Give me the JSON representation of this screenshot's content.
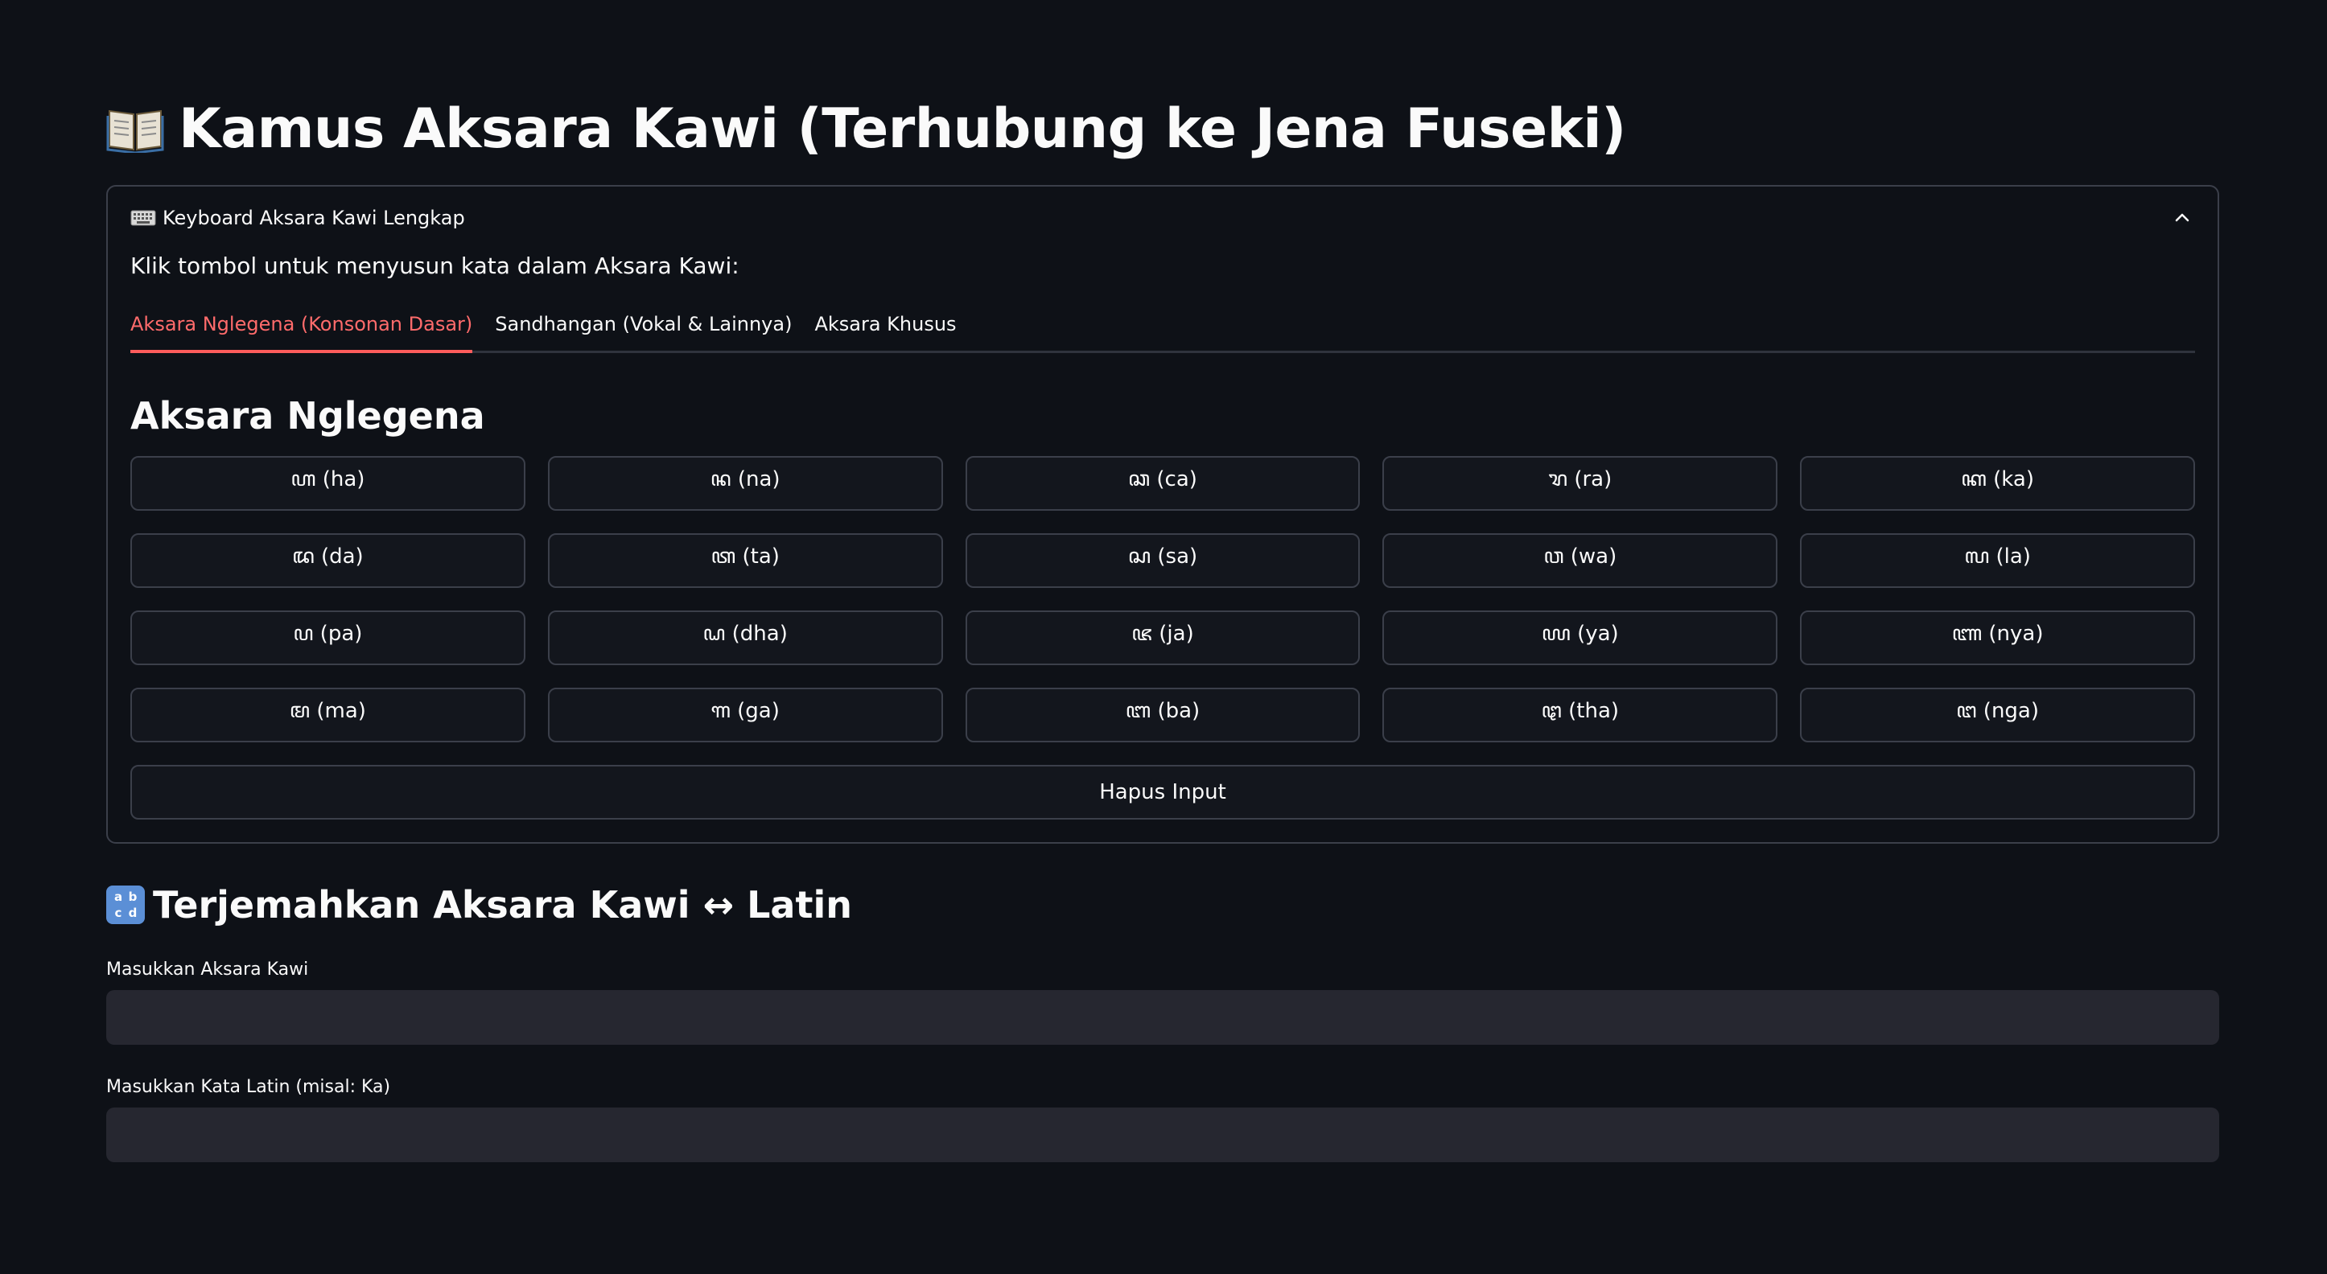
{
  "header": {
    "title": "Kamus Aksara Kawi (Terhubung ke Jena Fuseki)",
    "title_icon": "open-book-icon"
  },
  "expander": {
    "label": "Keyboard Aksara Kawi Lengkap",
    "icon": "keyboard-icon",
    "expanded": true,
    "instruction": "Klik tombol untuk menyusun kata dalam Aksara Kawi:",
    "tabs": [
      {
        "label": "Aksara Nglegena (Konsonan Dasar)",
        "active": true
      },
      {
        "label": "Sandhangan (Vokal & Lainnya)",
        "active": false
      },
      {
        "label": "Aksara Khusus",
        "active": false
      }
    ],
    "section_title": "Aksara Nglegena",
    "keys": [
      {
        "label": "ꦲ (ha)"
      },
      {
        "label": "ꦤ (na)"
      },
      {
        "label": "ꦕ (ca)"
      },
      {
        "label": "ꦫ (ra)"
      },
      {
        "label": "ꦏ (ka)"
      },
      {
        "label": "ꦢ (da)"
      },
      {
        "label": "ꦠ (ta)"
      },
      {
        "label": "ꦱ (sa)"
      },
      {
        "label": "ꦮ (wa)"
      },
      {
        "label": "ꦭ (la)"
      },
      {
        "label": "ꦥ (pa)"
      },
      {
        "label": "ꦝ (dha)"
      },
      {
        "label": "ꦗ (ja)"
      },
      {
        "label": "ꦪ (ya)"
      },
      {
        "label": "ꦚ (nya)"
      },
      {
        "label": "ꦩ (ma)"
      },
      {
        "label": "ꦒ (ga)"
      },
      {
        "label": "ꦧ (ba)"
      },
      {
        "label": "ꦛ (tha)"
      },
      {
        "label": "ꦔ (nga)"
      }
    ],
    "clear_button": "Hapus Input"
  },
  "translate": {
    "title": "Terjemahkan Aksara Kawi ↔ Latin",
    "title_icon": "abcd-icon",
    "kawi_label": "Masukkan Aksara Kawi",
    "kawi_value": "",
    "latin_label": "Masukkan Kata Latin (misal: Ka)",
    "latin_value": ""
  },
  "colors": {
    "background": "#0e1117",
    "accent": "#ff4b4b",
    "border": "#3b3f4a",
    "input_bg": "#262730"
  }
}
